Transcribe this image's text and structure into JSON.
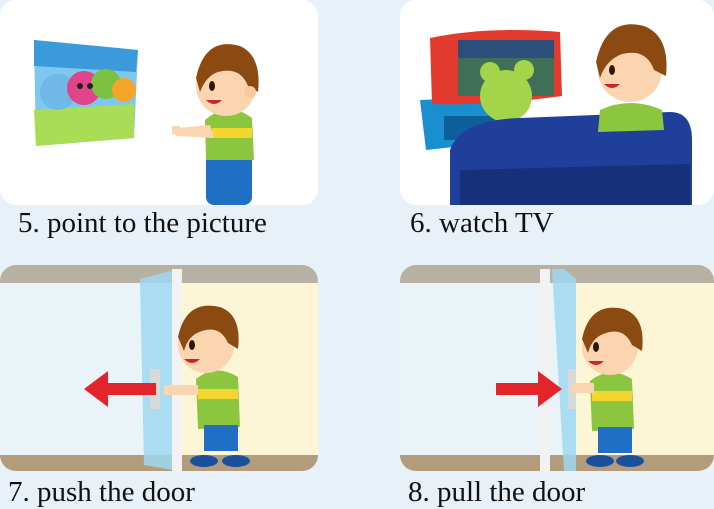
{
  "panels": [
    {
      "caption": "5. point to the picture"
    },
    {
      "caption": "6. watch TV"
    },
    {
      "caption": "7. push the door"
    },
    {
      "caption": "8. pull the door"
    }
  ],
  "colors": {
    "page_background": "#e8f1f8",
    "card_background": "#ffffff",
    "arrow": "#e3242b",
    "shirt_green": "#8cc63f",
    "shirt_yellow": "#f5d631",
    "pants_blue": "#1f6fc4",
    "hair_brown": "#8a4a12",
    "sofa_blue": "#1f3f9b",
    "tv_red": "#e23a2e",
    "door_glass": "#9fd8f0"
  },
  "icons": {
    "panel_5": "boy-pointing-at-picture",
    "panel_6": "boy-on-sofa-watching-tv",
    "panel_7": "boy-pushing-glass-door",
    "panel_8": "boy-pulling-glass-door",
    "direction_7": "arrow-left-icon",
    "direction_8": "arrow-right-icon"
  }
}
